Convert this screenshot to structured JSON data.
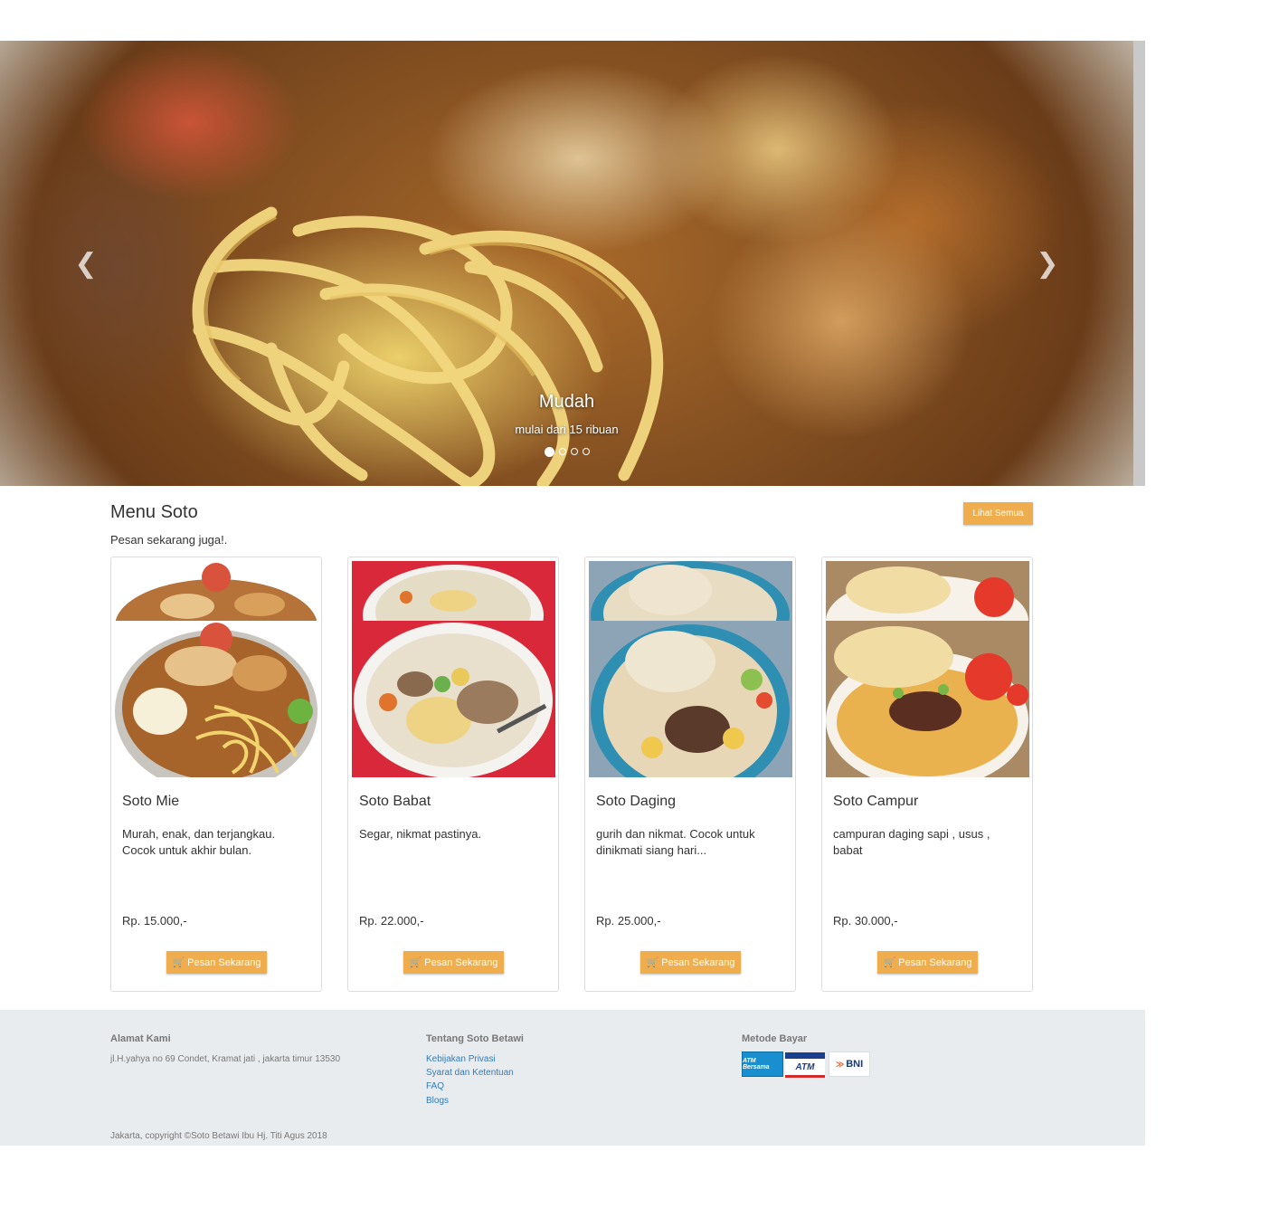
{
  "carousel": {
    "slides": [
      {
        "title": "Mudah",
        "subtitle": "mulai dari 15 ribuan"
      }
    ],
    "active_index": 0,
    "indicator_count": 4,
    "prev_icon": "chevron-left-icon",
    "next_icon": "chevron-right-icon"
  },
  "menu": {
    "title": "Menu Soto",
    "subtitle": "Pesan sekarang juga!.",
    "view_all_label": "Lihat Semua",
    "accent_color": "#f0ad4e",
    "items": [
      {
        "name": "Soto Mie",
        "description": "Murah, enak, dan terjangkau. Cocok untuk akhir bulan.",
        "price": "Rp. 15.000,-",
        "button": "Pesan Sekarang"
      },
      {
        "name": "Soto Babat",
        "description": "Segar, nikmat pastinya.",
        "price": "Rp. 22.000,-",
        "button": "Pesan Sekarang"
      },
      {
        "name": "Soto Daging",
        "description": "gurih dan nikmat. Cocok untuk dinikmati siang hari...",
        "price": "Rp. 25.000,-",
        "button": "Pesan Sekarang"
      },
      {
        "name": "Soto Campur",
        "description": "campuran daging sapi , usus , babat",
        "price": "Rp. 30.000,-",
        "button": "Pesan Sekarang"
      }
    ]
  },
  "footer": {
    "address": {
      "heading": "Alamat Kami",
      "text": "jl.H.yahya no 69 Condet, Kramat jati , jakarta timur 13530"
    },
    "about": {
      "heading": "Tentang Soto Betawi",
      "links": [
        "Kebijakan Privasi",
        "Syarat dan Ketentuan",
        "FAQ",
        "Blogs"
      ]
    },
    "payment": {
      "heading": "Metode Bayar",
      "logos": [
        "ATM Bersama",
        "ATM",
        "BNI"
      ]
    },
    "copyright": "Jakarta, copyright ©Soto Betawi Ibu Hj. Titi Agus 2018"
  }
}
